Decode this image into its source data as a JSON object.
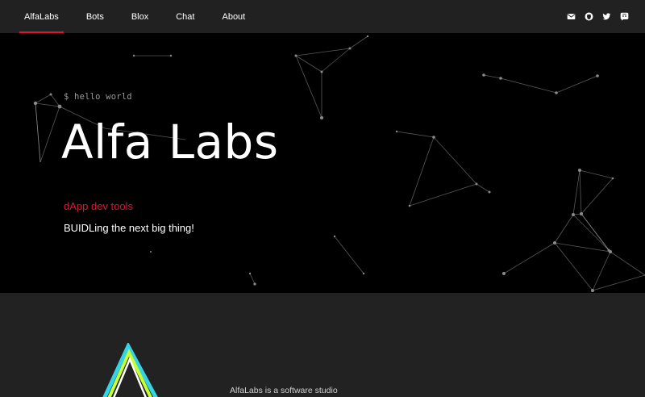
{
  "nav": {
    "items": [
      {
        "label": "AlfaLabs",
        "active": true
      },
      {
        "label": "Bots",
        "active": false
      },
      {
        "label": "Blox",
        "active": false
      },
      {
        "label": "Chat",
        "active": false
      },
      {
        "label": "About",
        "active": false
      }
    ],
    "icons": [
      "envelope-icon",
      "github-icon",
      "twitter-icon",
      "discord-icon"
    ],
    "accent_color": "#e2152e"
  },
  "hero": {
    "terminal": "$ hello world",
    "title": "Alfa Labs",
    "subtitle": "dApp dev tools",
    "tagline": "BUIDLing the next big thing!",
    "subtitle_color": "#e2152e"
  },
  "about": {
    "text": "AlfaLabs is a software studio",
    "logo_colors": [
      "#35d3e8",
      "#c8ff2e"
    ]
  }
}
